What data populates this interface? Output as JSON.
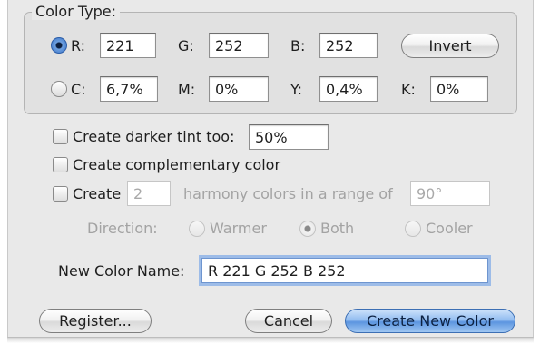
{
  "color_type": {
    "title": "Color Type:",
    "rgb": {
      "r_label": "R:",
      "r_value": "221",
      "g_label": "G:",
      "g_value": "252",
      "b_label": "B:",
      "b_value": "252",
      "selected": true
    },
    "cmyk": {
      "c_label": "C:",
      "c_value": "6,7%",
      "m_label": "M:",
      "m_value": "0%",
      "y_label": "Y:",
      "y_value": "0,4%",
      "k_label": "K:",
      "k_value": "0%",
      "selected": false
    },
    "invert_label": "Invert"
  },
  "options": {
    "darker_tint_label": "Create darker tint too:",
    "darker_tint_value": "50%",
    "darker_tint_checked": false,
    "complementary_label": "Create complementary color",
    "complementary_checked": false,
    "harmony_create_label": "Create",
    "harmony_count": "2",
    "harmony_range_label": "harmony colors in a range of",
    "harmony_range_value": "90°",
    "harmony_checked": false
  },
  "direction": {
    "label": "Direction:",
    "options": [
      "Warmer",
      "Both",
      "Cooler"
    ],
    "selected": "Both"
  },
  "name": {
    "label": "New Color Name:",
    "value": "R 221 G 252 B 252"
  },
  "buttons": {
    "register": "Register...",
    "cancel": "Cancel",
    "create": "Create New Color"
  },
  "colors": {
    "accent": "#5c95e0",
    "focus_ring": "#9dbce8",
    "dialog_bg": "#e9e9e9",
    "disabled_text": "#a3a3a3"
  }
}
